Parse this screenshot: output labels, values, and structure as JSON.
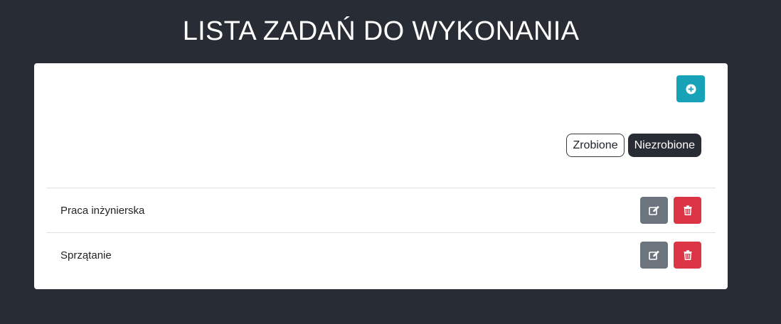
{
  "header": {
    "title": "LISTA ZADAŃ DO WYKONANIA"
  },
  "toolbar": {
    "add_icon": "plus-circle-icon"
  },
  "filters": [
    {
      "label": "Zrobione",
      "active": false
    },
    {
      "label": "Niezrobione",
      "active": true
    }
  ],
  "tasks": [
    {
      "label": "Praca inżynierska",
      "edit_icon": "edit-icon",
      "delete_icon": "trash-icon"
    },
    {
      "label": "Sprzątanie",
      "edit_icon": "edit-icon",
      "delete_icon": "trash-icon"
    }
  ],
  "colors": {
    "background": "#282c34",
    "card": "#ffffff",
    "add_button": "#17a2b8",
    "edit_button": "#6c757d",
    "delete_button": "#dc3545"
  }
}
